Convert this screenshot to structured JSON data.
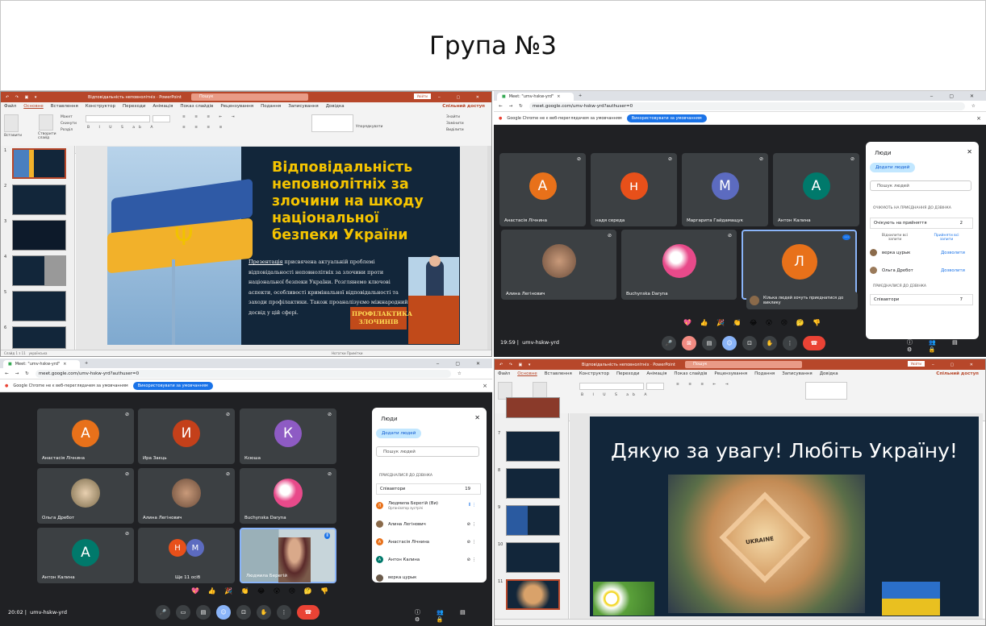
{
  "page": {
    "title": "Група №3"
  },
  "ppt1": {
    "doc_title": "Відповідальність неповнолітніх · PowerPoint",
    "search": "Пошук",
    "sign_in": "Увійти",
    "menu": [
      "Файл",
      "Основне",
      "Вставлення",
      "Конструктор",
      "Переходи",
      "Анімація",
      "Показ слайдів",
      "Рецензування",
      "Подання",
      "Записування",
      "Довідка"
    ],
    "share": "Спільний доступ",
    "ribbon_groups": [
      "Буфер обміну",
      "Слайди",
      "Шрифт",
      "Абзац",
      "Малювання",
      "Редагування"
    ],
    "ribbon_labels": {
      "paste": "Вставити",
      "new_slide": "Створити слайд",
      "layout": "Макет",
      "reset": "Скинути",
      "section": "Розділ",
      "find": "Знайти",
      "replace": "Замінити",
      "select": "Виділити",
      "arrange": "Упорядкувати"
    },
    "thumb_numbers": [
      "1",
      "2",
      "3",
      "4",
      "5",
      "6"
    ],
    "status_left": "Слайд 1 з 11",
    "status_lang": "українська",
    "status_right": "Нотатки   Примітки",
    "slide": {
      "heading": "Відповідальність неповнолітніх за злочини на шкоду національної безпеки України",
      "body_link": "Презентація",
      "body": " присвячена актуальній проблемі відповідальності неповнолітніх за злочини проти національної безпеки України. Розглянемо ключові аспекти, особливості кримінальної відповідальності та заходи профілактики. Також проаналізуємо міжнародний досвід у цій сфері.",
      "poster": "ПРОФІЛАКТИКА ЗЛОЧИНІВ"
    }
  },
  "meet1": {
    "tab": "Meet: \"umv-hskw-yrd\"",
    "url": "meet.google.com/umv-hskw-yrd?authuser=0",
    "info": "Google Chrome не є веб-переглядачем за умовчанням",
    "info_btn": "Використовувати за умовчанням",
    "tiles": [
      {
        "name": "Анастасія Лічнина",
        "letter": "А",
        "color": "#e8711a"
      },
      {
        "name": "надя середа",
        "letter": "н",
        "color": "#e8501a"
      },
      {
        "name": "Маргарита Гайдамащук",
        "letter": "М",
        "color": "#5c6bc0"
      },
      {
        "name": "Антон Калина",
        "letter": "А",
        "color": "#00796b"
      },
      {
        "name": "Алина Легінович",
        "letter": ""
      },
      {
        "name": "Buchynska Daryna",
        "letter": ""
      },
      {
        "name": "Кілька людей хочуть приєднатися до виклику",
        "letter": "Л",
        "color": "#e8711a"
      }
    ],
    "time": "19:59",
    "code": "umv-hskw-yrd",
    "emojis": "💖 👍 🎉 👏 😂 😮 😢 🤔 👎",
    "people": {
      "title": "Люди",
      "add": "Додати людей",
      "search": "Пошук людей",
      "waiting_section": "ОЧІКУЮТЬ НА ПРИЄДНАННЯ ДО ДЗВІНКА",
      "waiting_label": "Очікують на прийняття",
      "waiting_count": "2",
      "deny_all": "Відхилити всі запити",
      "accept_all": "Прийняти всі запити",
      "waiting": [
        {
          "name": "верка цурык",
          "action": "Дозволити"
        },
        {
          "name": "Ольга Дребот",
          "action": "Дозволити"
        }
      ],
      "joined_section": "ПРИЄДНАЛИСЯ ДО ДЗВІНКА",
      "co_label": "Співавтори",
      "co_count": "7"
    }
  },
  "meet2": {
    "tab": "Meet: \"umv-hskw-yrd\"",
    "url": "meet.google.com/umv-hskw-yrd?authuser=0",
    "info": "Google Chrome не є веб-переглядачем за умовчанням",
    "info_btn": "Використовувати за умовчанням",
    "tiles": [
      {
        "name": "Анастасія Лічнина",
        "letter": "А",
        "color": "#e8711a"
      },
      {
        "name": "Ира Заєць",
        "letter": "И",
        "color": "#c4401a"
      },
      {
        "name": "Ксюша",
        "letter": "К",
        "color": "#8e5bc4"
      },
      {
        "name": "Ольга Дребот",
        "letter": ""
      },
      {
        "name": "Алина Легінович",
        "letter": ""
      },
      {
        "name": "Buchynska Daryna",
        "letter": ""
      },
      {
        "name": "Антон Калина",
        "letter": "А",
        "color": "#00796b"
      },
      {
        "name": "Ще 11 осіб",
        "letter": ""
      },
      {
        "name": "Людмила Берегій",
        "letter": ""
      }
    ],
    "more_letters": [
      "Н",
      "М"
    ],
    "time": "20:02",
    "code": "umv-hskw-yrd",
    "emojis": "💖 👍 🎉 👏 😂 😮 😢 🤔 👎",
    "people": {
      "title": "Люди",
      "add": "Додати людей",
      "search": "Пошук людей",
      "joined_section": "ПРИЄДНАЛИСЯ ДО ДЗВІНКА",
      "co_label": "Співавтори",
      "co_count": "19",
      "list": [
        {
          "name": "Людмила Берегій (Ви)",
          "sub": "Організатор зустрічі",
          "letter": "Л",
          "color": "#e8711a"
        },
        {
          "name": "Алина Легінович",
          "letter": "",
          "color": "#8a6a4a"
        },
        {
          "name": "Анастасія Лічнина",
          "letter": "А",
          "color": "#e8711a"
        },
        {
          "name": "Антон Калина",
          "letter": "А",
          "color": "#00796b"
        },
        {
          "name": "верка цурык",
          "letter": "",
          "color": "#6a5a4a"
        }
      ]
    }
  },
  "ppt2": {
    "doc_title": "Відповідальність неповнолітніх · PowerPoint",
    "search": "Пошук",
    "sign_in": "Увійти",
    "menu": [
      "Файл",
      "Основне",
      "Вставлення",
      "Конструктор",
      "Переходи",
      "Анімація",
      "Показ слайдів",
      "Рецензування",
      "Подання",
      "Записування",
      "Довідка"
    ],
    "share": "Спільний доступ",
    "thumb_numbers": [
      "7",
      "8",
      "9",
      "10",
      "11"
    ],
    "slide": {
      "thanks": "Дякую за увагу! Любіть Україну!",
      "map_word": "UKRAINE"
    }
  }
}
